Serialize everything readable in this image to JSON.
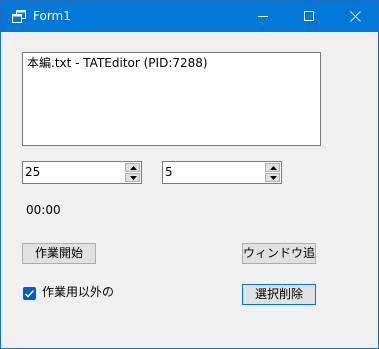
{
  "window": {
    "title": "Form1",
    "accent_color": "#0078d7",
    "controls": {
      "minimize_icon": "minimize-icon",
      "maximize_icon": "maximize-icon",
      "close_icon": "close-icon"
    }
  },
  "listbox": {
    "items": [
      "本編.txt - TATEditor (PID:7288)"
    ]
  },
  "numeric_1": {
    "value": "25"
  },
  "numeric_2": {
    "value": "5"
  },
  "timer": {
    "text": "00:00"
  },
  "buttons": {
    "start": "作業開始",
    "window_capture": "ウィンドウ追",
    "delete_selected": "選択削除"
  },
  "checkbox": {
    "label": "作業用以外の",
    "checked": true
  }
}
